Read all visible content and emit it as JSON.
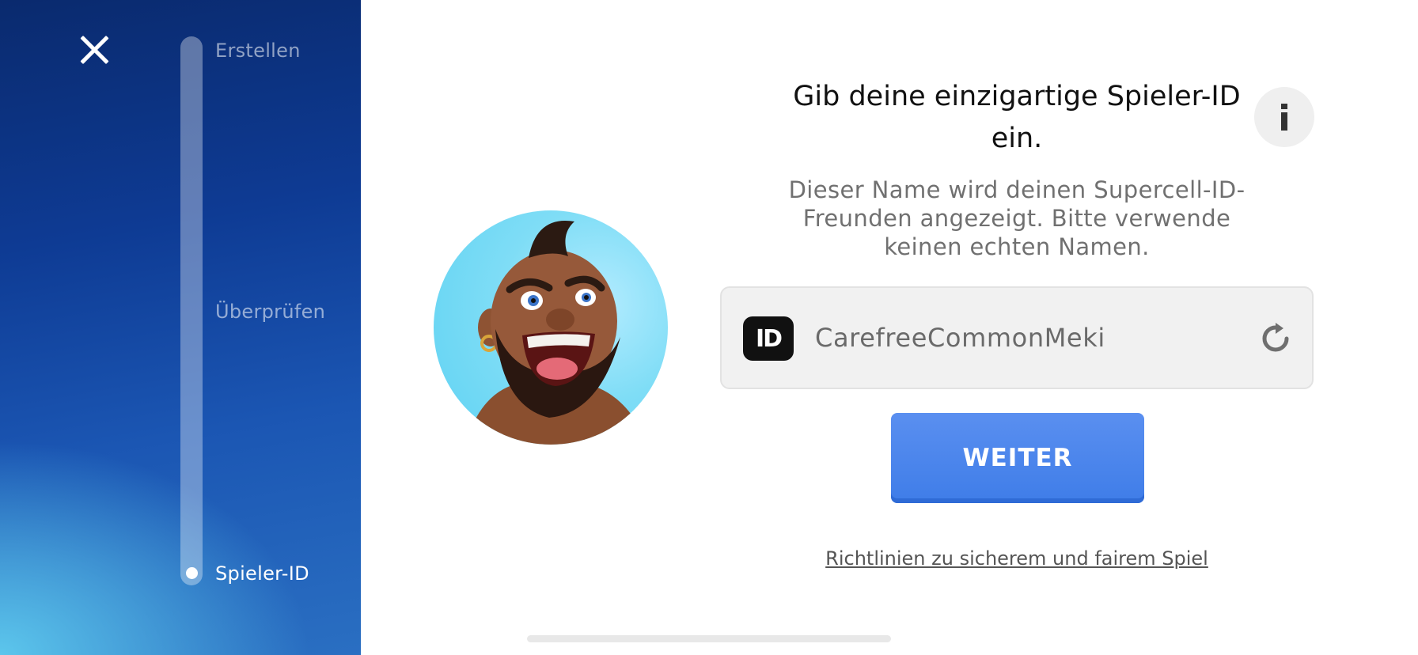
{
  "progress": {
    "steps": [
      {
        "label": "Erstellen",
        "state": "done"
      },
      {
        "label": "Überprüfen",
        "state": "done"
      },
      {
        "label": "Spieler-ID",
        "state": "current"
      }
    ]
  },
  "main": {
    "title": "Gib deine einzigartige Spieler-ID ein.",
    "subtitle": "Dieser Name wird deinen Supercell-ID-Freunden angezeigt. Bitte verwende keinen echten Namen.",
    "id_field": {
      "logo_text": "ID",
      "value": "CarefreeCommonMeki",
      "refresh_icon": "refresh-icon"
    },
    "continue_label": "WEITER",
    "policy_link": "Richtlinien zu sicherem und fairem Spiel",
    "info_icon": "info-icon"
  },
  "colors": {
    "accent": "#4a86ec",
    "panel_dark": "#0a2a6e",
    "panel_light": "#5cc6ec"
  }
}
